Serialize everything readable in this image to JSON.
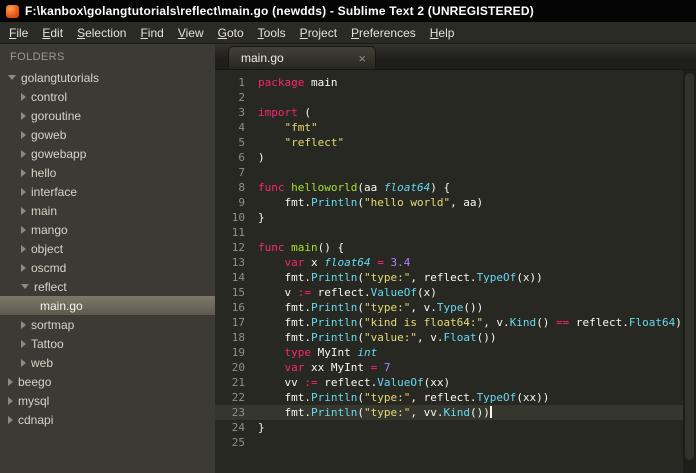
{
  "window": {
    "title": "F:\\kanbox\\golangtutorials\\reflect\\main.go (newdds) - Sublime Text 2 (UNREGISTERED)"
  },
  "menu": {
    "items": [
      "File",
      "Edit",
      "Selection",
      "Find",
      "View",
      "Goto",
      "Tools",
      "Project",
      "Preferences",
      "Help"
    ]
  },
  "sidebar": {
    "header": "FOLDERS",
    "items": [
      {
        "label": "golangtutorials",
        "depth": 0,
        "kind": "folder",
        "state": "expanded"
      },
      {
        "label": "control",
        "depth": 1,
        "kind": "folder",
        "state": "collapsed"
      },
      {
        "label": "goroutine",
        "depth": 1,
        "kind": "folder",
        "state": "collapsed"
      },
      {
        "label": "goweb",
        "depth": 1,
        "kind": "folder",
        "state": "collapsed"
      },
      {
        "label": "gowebapp",
        "depth": 1,
        "kind": "folder",
        "state": "collapsed"
      },
      {
        "label": "hello",
        "depth": 1,
        "kind": "folder",
        "state": "collapsed"
      },
      {
        "label": "interface",
        "depth": 1,
        "kind": "folder",
        "state": "collapsed"
      },
      {
        "label": "main",
        "depth": 1,
        "kind": "folder",
        "state": "collapsed"
      },
      {
        "label": "mango",
        "depth": 1,
        "kind": "folder",
        "state": "collapsed"
      },
      {
        "label": "object",
        "depth": 1,
        "kind": "folder",
        "state": "collapsed"
      },
      {
        "label": "oscmd",
        "depth": 1,
        "kind": "folder",
        "state": "collapsed"
      },
      {
        "label": "reflect",
        "depth": 1,
        "kind": "folder",
        "state": "expanded"
      },
      {
        "label": "main.go",
        "depth": 2,
        "kind": "file",
        "selected": true
      },
      {
        "label": "sortmap",
        "depth": 1,
        "kind": "folder",
        "state": "collapsed"
      },
      {
        "label": "Tattoo",
        "depth": 1,
        "kind": "folder",
        "state": "collapsed"
      },
      {
        "label": "web",
        "depth": 1,
        "kind": "folder",
        "state": "collapsed"
      },
      {
        "label": "beego",
        "depth": 0,
        "kind": "folder",
        "state": "collapsed"
      },
      {
        "label": "mysql",
        "depth": 0,
        "kind": "folder",
        "state": "collapsed"
      },
      {
        "label": "cdnapi",
        "depth": 0,
        "kind": "folder",
        "state": "collapsed"
      }
    ]
  },
  "editor": {
    "tab": {
      "label": "main.go",
      "close_icon": "×"
    },
    "active_line": 23,
    "lines": [
      {
        "n": 1,
        "tokens": [
          [
            "package",
            "kw"
          ],
          [
            " main",
            "pl"
          ]
        ]
      },
      {
        "n": 2,
        "tokens": []
      },
      {
        "n": 3,
        "tokens": [
          [
            "import",
            "kw"
          ],
          [
            " (",
            "pl"
          ]
        ]
      },
      {
        "n": 4,
        "tokens": [
          [
            "    ",
            "pl"
          ],
          [
            "\"fmt\"",
            "str"
          ]
        ]
      },
      {
        "n": 5,
        "tokens": [
          [
            "    ",
            "pl"
          ],
          [
            "\"reflect\"",
            "str"
          ]
        ]
      },
      {
        "n": 6,
        "tokens": [
          [
            ")",
            "pl"
          ]
        ]
      },
      {
        "n": 7,
        "tokens": []
      },
      {
        "n": 8,
        "tokens": [
          [
            "func",
            "kw"
          ],
          [
            " ",
            "pl"
          ],
          [
            "helloworld",
            "fn"
          ],
          [
            "(aa ",
            "pl"
          ],
          [
            "float64",
            "type"
          ],
          [
            ") {",
            "pl"
          ]
        ]
      },
      {
        "n": 9,
        "tokens": [
          [
            "    fmt.",
            "pl"
          ],
          [
            "Println",
            "sup"
          ],
          [
            "(",
            "pl"
          ],
          [
            "\"hello world\"",
            "str"
          ],
          [
            ", aa)",
            "pl"
          ]
        ]
      },
      {
        "n": 10,
        "tokens": [
          [
            "}",
            "pl"
          ]
        ]
      },
      {
        "n": 11,
        "tokens": []
      },
      {
        "n": 12,
        "tokens": [
          [
            "func",
            "kw"
          ],
          [
            " ",
            "pl"
          ],
          [
            "main",
            "fn"
          ],
          [
            "() {",
            "pl"
          ]
        ]
      },
      {
        "n": 13,
        "tokens": [
          [
            "    ",
            "pl"
          ],
          [
            "var",
            "kw"
          ],
          [
            " x ",
            "pl"
          ],
          [
            "float64",
            "type"
          ],
          [
            " ",
            "pl"
          ],
          [
            "=",
            "kw"
          ],
          [
            " ",
            "pl"
          ],
          [
            "3.4",
            "num"
          ]
        ]
      },
      {
        "n": 14,
        "tokens": [
          [
            "    fmt.",
            "pl"
          ],
          [
            "Println",
            "sup"
          ],
          [
            "(",
            "pl"
          ],
          [
            "\"type:\"",
            "str"
          ],
          [
            ", reflect.",
            "pl"
          ],
          [
            "TypeOf",
            "sup"
          ],
          [
            "(x))",
            "pl"
          ]
        ]
      },
      {
        "n": 15,
        "tokens": [
          [
            "    v ",
            "pl"
          ],
          [
            ":=",
            "kw"
          ],
          [
            " reflect.",
            "pl"
          ],
          [
            "ValueOf",
            "sup"
          ],
          [
            "(x)",
            "pl"
          ]
        ]
      },
      {
        "n": 16,
        "tokens": [
          [
            "    fmt.",
            "pl"
          ],
          [
            "Println",
            "sup"
          ],
          [
            "(",
            "pl"
          ],
          [
            "\"type:\"",
            "str"
          ],
          [
            ", v.",
            "pl"
          ],
          [
            "Type",
            "sup"
          ],
          [
            "())",
            "pl"
          ]
        ]
      },
      {
        "n": 17,
        "tokens": [
          [
            "    fmt.",
            "pl"
          ],
          [
            "Println",
            "sup"
          ],
          [
            "(",
            "pl"
          ],
          [
            "\"kind is float64:\"",
            "str"
          ],
          [
            ", v.",
            "pl"
          ],
          [
            "Kind",
            "sup"
          ],
          [
            "() ",
            "pl"
          ],
          [
            "==",
            "kw"
          ],
          [
            " reflect.",
            "pl"
          ],
          [
            "Float64",
            "sup"
          ],
          [
            ")",
            "pl"
          ]
        ]
      },
      {
        "n": 18,
        "tokens": [
          [
            "    fmt.",
            "pl"
          ],
          [
            "Println",
            "sup"
          ],
          [
            "(",
            "pl"
          ],
          [
            "\"value:\"",
            "str"
          ],
          [
            ", v.",
            "pl"
          ],
          [
            "Float",
            "sup"
          ],
          [
            "())",
            "pl"
          ]
        ]
      },
      {
        "n": 19,
        "tokens": [
          [
            "    ",
            "pl"
          ],
          [
            "type",
            "kw"
          ],
          [
            " MyInt ",
            "pl"
          ],
          [
            "int",
            "type"
          ]
        ]
      },
      {
        "n": 20,
        "tokens": [
          [
            "    ",
            "pl"
          ],
          [
            "var",
            "kw"
          ],
          [
            " xx MyInt ",
            "pl"
          ],
          [
            "=",
            "kw"
          ],
          [
            " ",
            "pl"
          ],
          [
            "7",
            "num"
          ]
        ]
      },
      {
        "n": 21,
        "tokens": [
          [
            "    vv ",
            "pl"
          ],
          [
            ":=",
            "kw"
          ],
          [
            " reflect.",
            "pl"
          ],
          [
            "ValueOf",
            "sup"
          ],
          [
            "(xx)",
            "pl"
          ]
        ]
      },
      {
        "n": 22,
        "tokens": [
          [
            "    fmt.",
            "pl"
          ],
          [
            "Println",
            "sup"
          ],
          [
            "(",
            "pl"
          ],
          [
            "\"type:\"",
            "str"
          ],
          [
            ", reflect.",
            "pl"
          ],
          [
            "TypeOf",
            "sup"
          ],
          [
            "(xx))",
            "pl"
          ]
        ]
      },
      {
        "n": 23,
        "tokens": [
          [
            "    fmt.",
            "pl"
          ],
          [
            "Println",
            "sup"
          ],
          [
            "(",
            "pl"
          ],
          [
            "\"type:\"",
            "str"
          ],
          [
            ", vv.",
            "pl"
          ],
          [
            "Kind",
            "sup"
          ],
          [
            "())",
            "pl"
          ]
        ],
        "caret": true
      },
      {
        "n": 24,
        "tokens": [
          [
            "}",
            "pl"
          ]
        ]
      },
      {
        "n": 25,
        "tokens": []
      }
    ]
  },
  "colors": {
    "editor_background": "#272822",
    "foreground": "#f8f8f2",
    "keyword": "#f92672",
    "string": "#e6db74",
    "function_name": "#a6e22e",
    "type_italic": "#66d9ef",
    "support_function": "#66d9ef",
    "number": "#ae81ff",
    "line_number": "#8f908a",
    "sidebar_background": "#3b3a35",
    "titlebar_background": "#050505",
    "selection_bar": "#7d7969"
  }
}
